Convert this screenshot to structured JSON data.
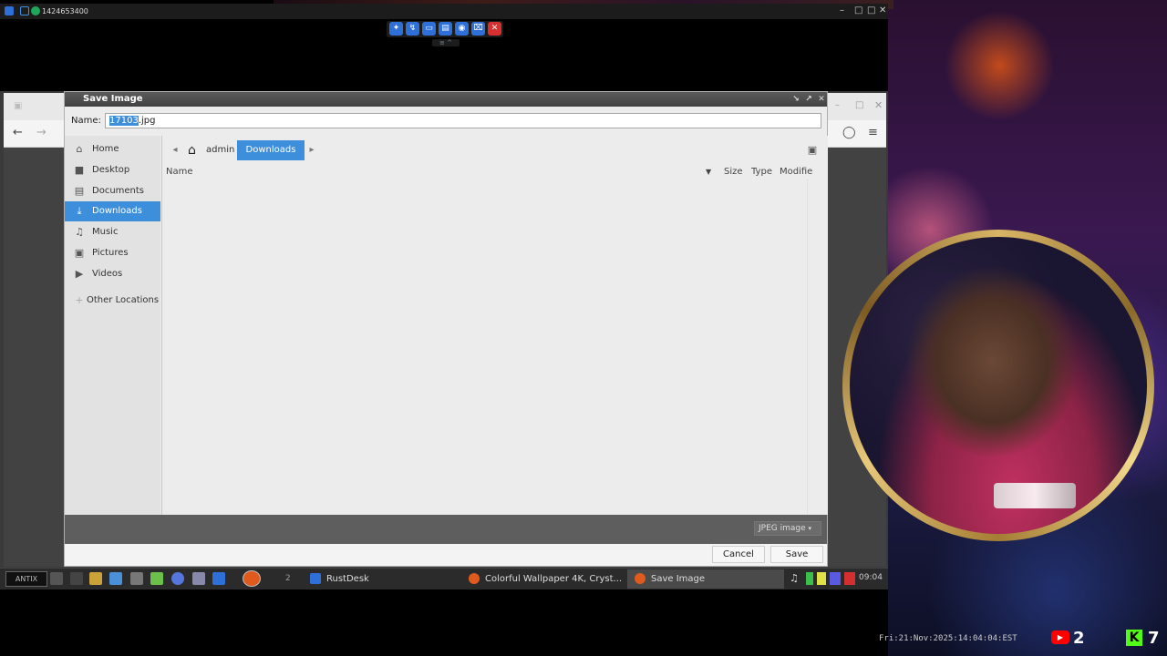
{
  "remote": {
    "session_id": "1424653400",
    "toolbar_buttons": [
      "pin-icon",
      "lightning-icon",
      "monitor-icon",
      "display-icon",
      "chat-icon",
      "keyboard-icon",
      "close-icon"
    ]
  },
  "dialog": {
    "title": "Save Image",
    "name_label": "Name:",
    "filename_selected": "17103",
    "filename_ext": ".jpg",
    "sidebar": [
      {
        "label": "Home",
        "icon": "home-icon"
      },
      {
        "label": "Desktop",
        "icon": "desktop-icon"
      },
      {
        "label": "Documents",
        "icon": "documents-icon"
      },
      {
        "label": "Downloads",
        "icon": "download-icon",
        "active": true
      },
      {
        "label": "Music",
        "icon": "music-icon"
      },
      {
        "label": "Pictures",
        "icon": "pictures-icon"
      },
      {
        "label": "Videos",
        "icon": "videos-icon"
      },
      {
        "label": "Other Locations",
        "icon": "plus-icon"
      }
    ],
    "path": {
      "home": "admin",
      "current": "Downloads"
    },
    "columns": {
      "name": "Name",
      "size": "Size",
      "type": "Type",
      "modified": "Modifie"
    },
    "filetype": "JPEG image",
    "cancel_label": "Cancel",
    "save_label": "Save"
  },
  "taskbar": {
    "start_label": "ANTIX",
    "workspace": "2",
    "tasks": [
      {
        "label": "RustDesk"
      },
      {
        "label": "Colorful Wallpaper 4K, Cryst..."
      },
      {
        "label": "Save Image",
        "active": true
      }
    ],
    "clock": "09:04"
  },
  "overlay": {
    "timestamp": "Fri:21:Nov:2025:14:04:04:EST",
    "youtube_count": "2",
    "kick_count": "7"
  },
  "colors": {
    "accent": "#3d8fdc",
    "rustdesk_blue": "#2f6fd8",
    "close_red": "#d63030",
    "youtube_red": "#ff0000",
    "kick_green": "#53fc18"
  }
}
